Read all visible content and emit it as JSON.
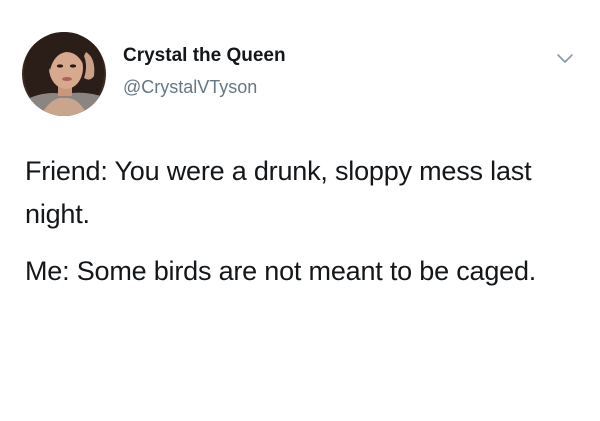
{
  "tweet": {
    "display_name": "Crystal the Queen",
    "handle": "@CrystalVTyson",
    "menu_icon": "chevron-down-icon",
    "avatar_icon": "profile-photo",
    "paragraphs": [
      "Friend: You were a drunk, sloppy mess last night.",
      "Me: Some birds are not meant to be caged."
    ]
  },
  "colors": {
    "text": "#14171a",
    "secondary_text": "#657786",
    "chevron": "#8899a6",
    "background": "#ffffff"
  }
}
